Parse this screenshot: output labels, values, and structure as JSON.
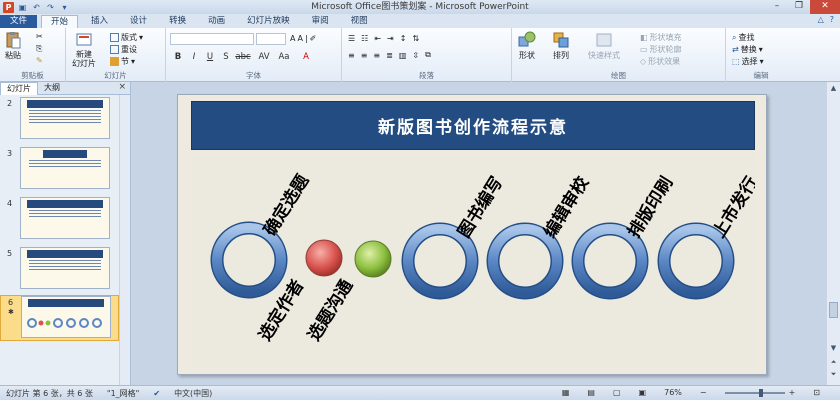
{
  "window": {
    "title": "Microsoft Office图书策划案 - Microsoft PowerPoint",
    "logo": "P"
  },
  "tabs": [
    "文件",
    "开始",
    "插入",
    "设计",
    "转换",
    "动画",
    "幻灯片放映",
    "审阅",
    "视图"
  ],
  "ribbon": {
    "clipboard": {
      "paste": "粘贴",
      "label": "剪贴板"
    },
    "slides": {
      "new_slide": "新建\n幻灯片",
      "layout": "版式",
      "reset": "重设",
      "section": "节",
      "label": "幻灯片"
    },
    "font": {
      "label": "字体",
      "bold": "B",
      "italic": "I",
      "underline": "U",
      "strike": "S",
      "shadow": "abc"
    },
    "paragraph": {
      "label": "段落"
    },
    "drawing": {
      "shapes": "形状",
      "arrange": "排列",
      "quick_styles": "快速样式",
      "fill": "形状填充",
      "outline": "形状轮廓",
      "effects": "形状效果",
      "label": "绘图"
    },
    "editing": {
      "find": "查找",
      "replace": "替换",
      "select": "选择",
      "label": "编辑"
    }
  },
  "leftpane": {
    "tab_slides": "幻灯片",
    "tab_outline": "大纲",
    "close": "×",
    "thumbnails": [
      {
        "num": "2",
        "selected": false
      },
      {
        "num": "3",
        "selected": false
      },
      {
        "num": "4",
        "selected": false
      },
      {
        "num": "5",
        "selected": false
      },
      {
        "num": "6",
        "selected": true
      }
    ]
  },
  "slide": {
    "title": "新版图书创作流程示意",
    "steps_top": [
      "确定选题",
      "图书编写",
      "编辑审校",
      "排版印刷",
      "上市发行"
    ],
    "steps_bottom": [
      "选定作者",
      "选题沟通"
    ],
    "colors": {
      "ring": "#5b87c5",
      "red": "#d9534f",
      "green": "#8cbf3f",
      "title_bg": "#234c82"
    }
  },
  "status": {
    "slide_info": "幻灯片 第 6 张，共 6 张",
    "theme": "\"1_网格\"",
    "language": "中文(中国)",
    "zoom": "76%"
  }
}
